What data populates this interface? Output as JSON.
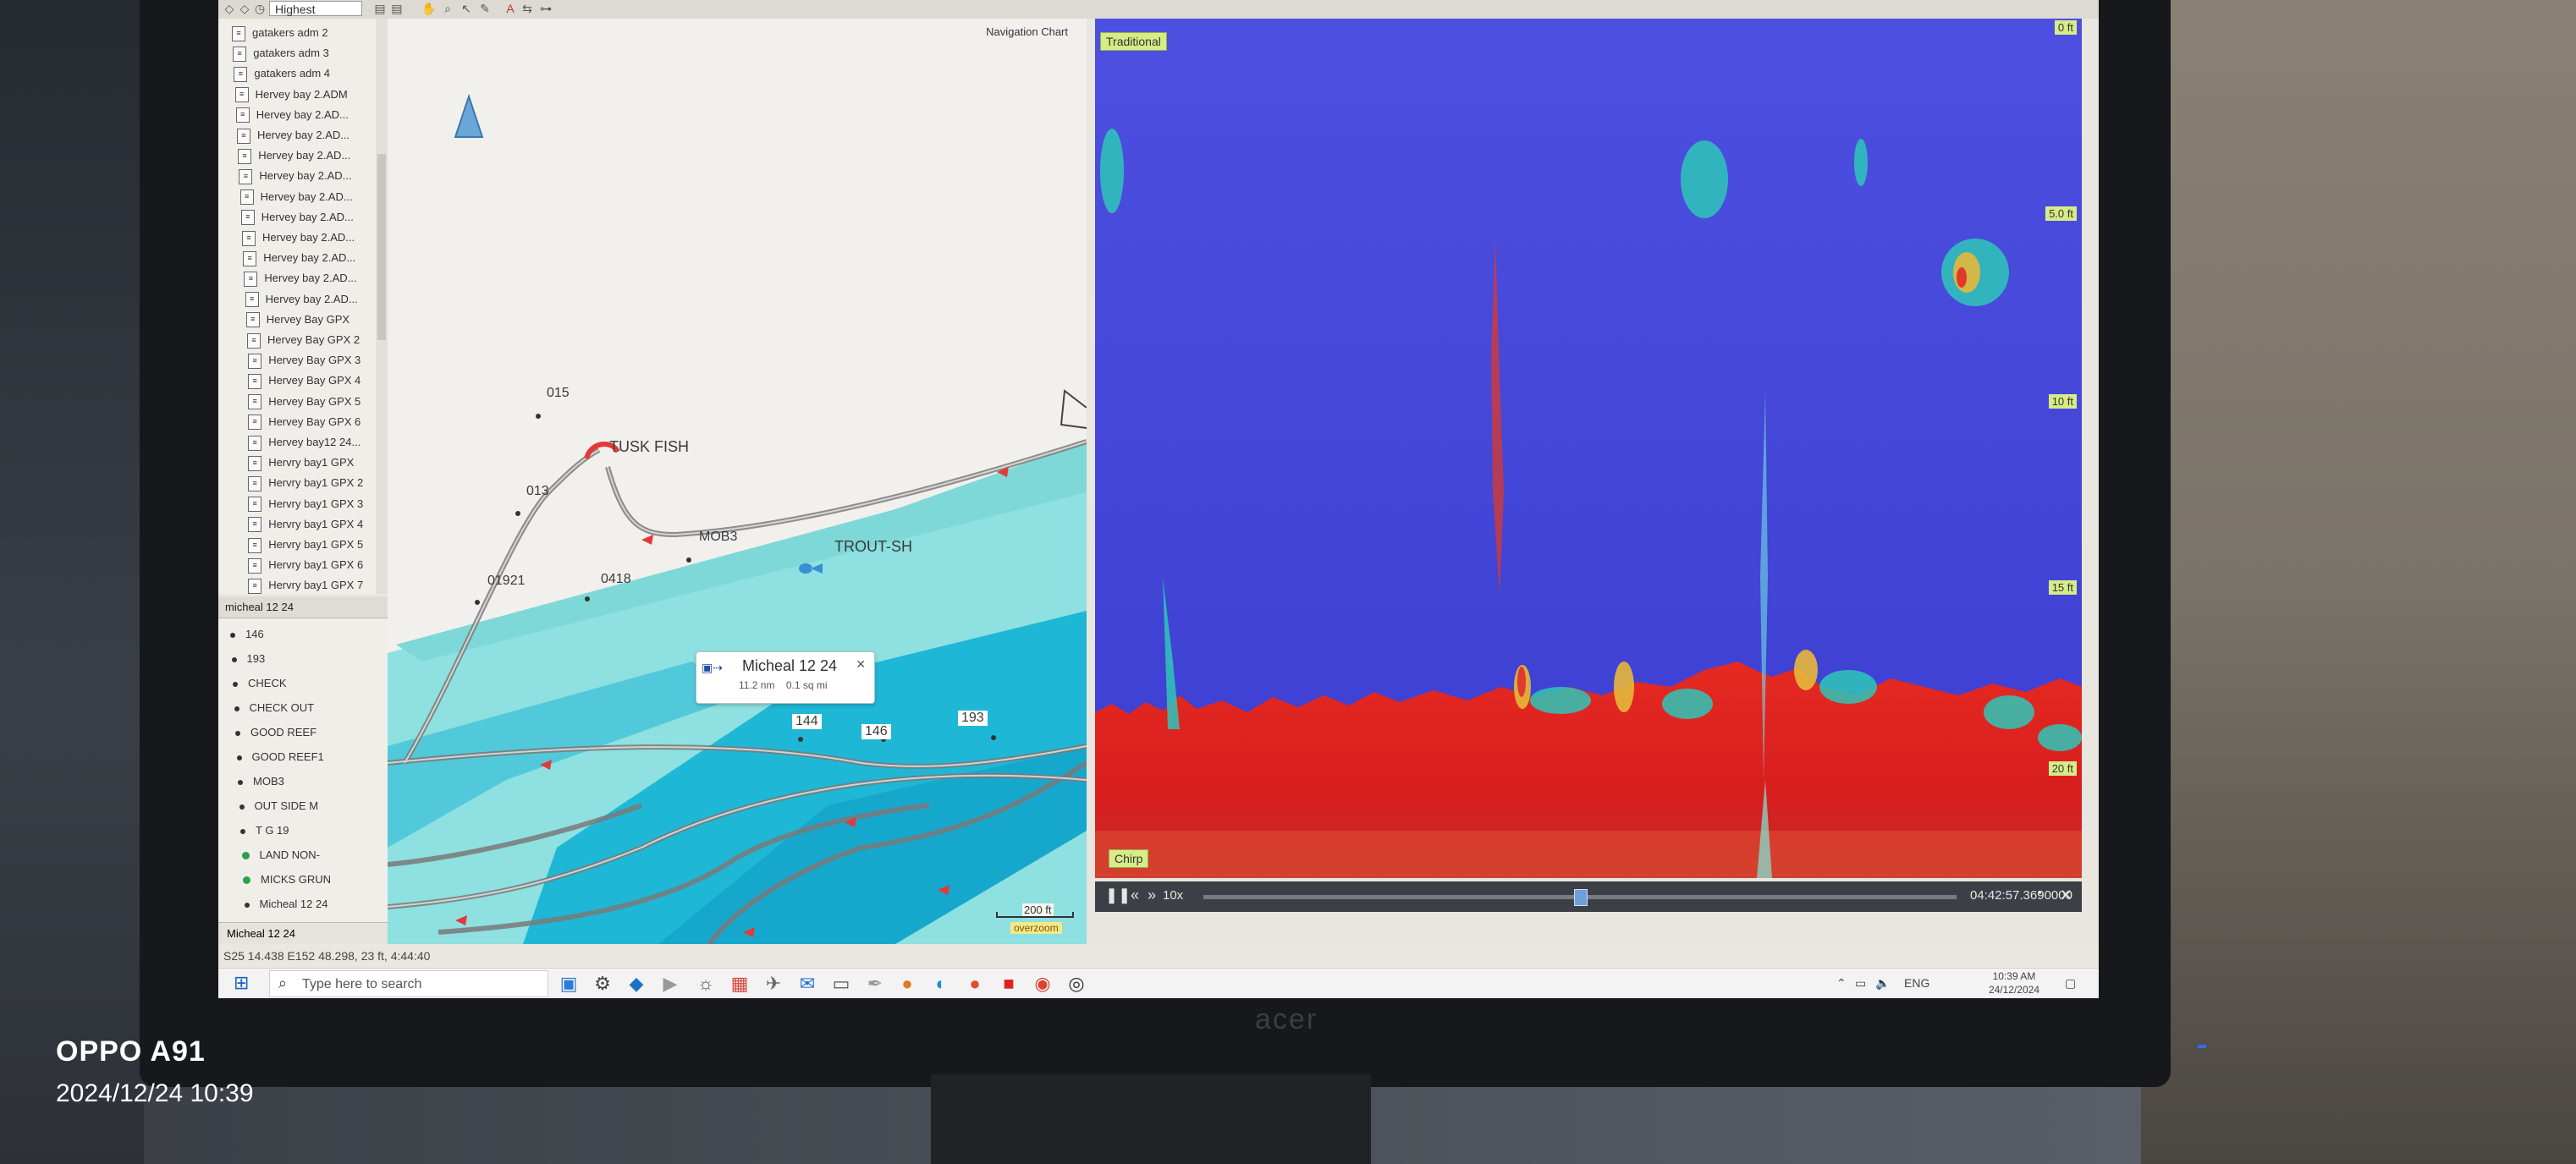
{
  "toolbar": {
    "quality_select": "Highest"
  },
  "tree": {
    "items": [
      "gatakers adm 2",
      "gatakers adm 3",
      "gatakers adm 4",
      "Hervey bay 2.ADM",
      "Hervey bay 2.AD...",
      "Hervey bay 2.AD...",
      "Hervey bay 2.AD...",
      "Hervey bay 2.AD...",
      "Hervey bay 2.AD...",
      "Hervey bay 2.AD...",
      "Hervey bay 2.AD...",
      "Hervey bay 2.AD...",
      "Hervey bay 2.AD...",
      "Hervey bay 2.AD...",
      "Hervey Bay GPX",
      "Hervey Bay GPX 2",
      "Hervey Bay GPX 3",
      "Hervey Bay GPX 4",
      "Hervey Bay GPX 5",
      "Hervey Bay GPX 6",
      "Hervey bay12 24...",
      "Hervry bay1 GPX",
      "Hervry bay1 GPX 2",
      "Hervry bay1 GPX 3",
      "Hervry bay1 GPX 4",
      "Hervry bay1 GPX 5",
      "Hervry bay1 GPX 6",
      "Hervry bay1 GPX 7"
    ]
  },
  "waypoints": {
    "section_title": "micheal 12 24",
    "items": [
      {
        "label": "146",
        "green": false
      },
      {
        "label": "193",
        "green": false
      },
      {
        "label": "CHECK",
        "green": false
      },
      {
        "label": "CHECK OUT",
        "green": false
      },
      {
        "label": "GOOD REEF",
        "green": false
      },
      {
        "label": "GOOD REEF1",
        "green": false
      },
      {
        "label": "MOB3",
        "green": false
      },
      {
        "label": "OUT SIDE M",
        "green": false
      },
      {
        "label": "T G 19",
        "green": false
      },
      {
        "label": "LAND NON-",
        "green": true
      },
      {
        "label": "MICKS GRUN",
        "green": true
      },
      {
        "label": "Micheal 12 24",
        "green": false
      }
    ],
    "bottom_select": "Micheal 12 24"
  },
  "status_bar": {
    "text": "S25 14.438 E152 48.298, 23 ft, 4:44:40"
  },
  "chart": {
    "title": "Navigation Chart",
    "labels": {
      "p015": "015",
      "tusk": "TUSK FISH",
      "p013": "013",
      "mob3": "MOB3",
      "trout": "TROUT-SH",
      "p01921": "01921",
      "p0418": "0418",
      "p144": "144",
      "p146": "146",
      "p193": "193"
    },
    "popup": {
      "title": "Micheal 12 24",
      "distance": "11.2 nm",
      "area": "0.1 sq mi"
    },
    "scale": {
      "distance": "200 ft",
      "mode": "overzoom"
    }
  },
  "sonar": {
    "mode_tag": "Traditional",
    "freq_tag": "Chirp",
    "depths": [
      "0 ft",
      "5.0 ft",
      "10 ft",
      "15 ft",
      "20 ft"
    ],
    "playback": {
      "speed": "10x",
      "time": "04:42:57.3690000"
    }
  },
  "taskbar": {
    "search_placeholder": "Type here to search",
    "language": "ENG",
    "time": "10:39 AM",
    "date": "24/12/2024"
  },
  "watermark": {
    "model": "OPPO A91",
    "datetime": "2024/12/24 10:39"
  },
  "colors": {
    "water_shallow": "#8fe0e0",
    "water_deep": "#1fb7d6",
    "sonar_bg": "#4a4edc",
    "sonar_bottom": "#e02424",
    "route_red": "#e23a3a"
  }
}
